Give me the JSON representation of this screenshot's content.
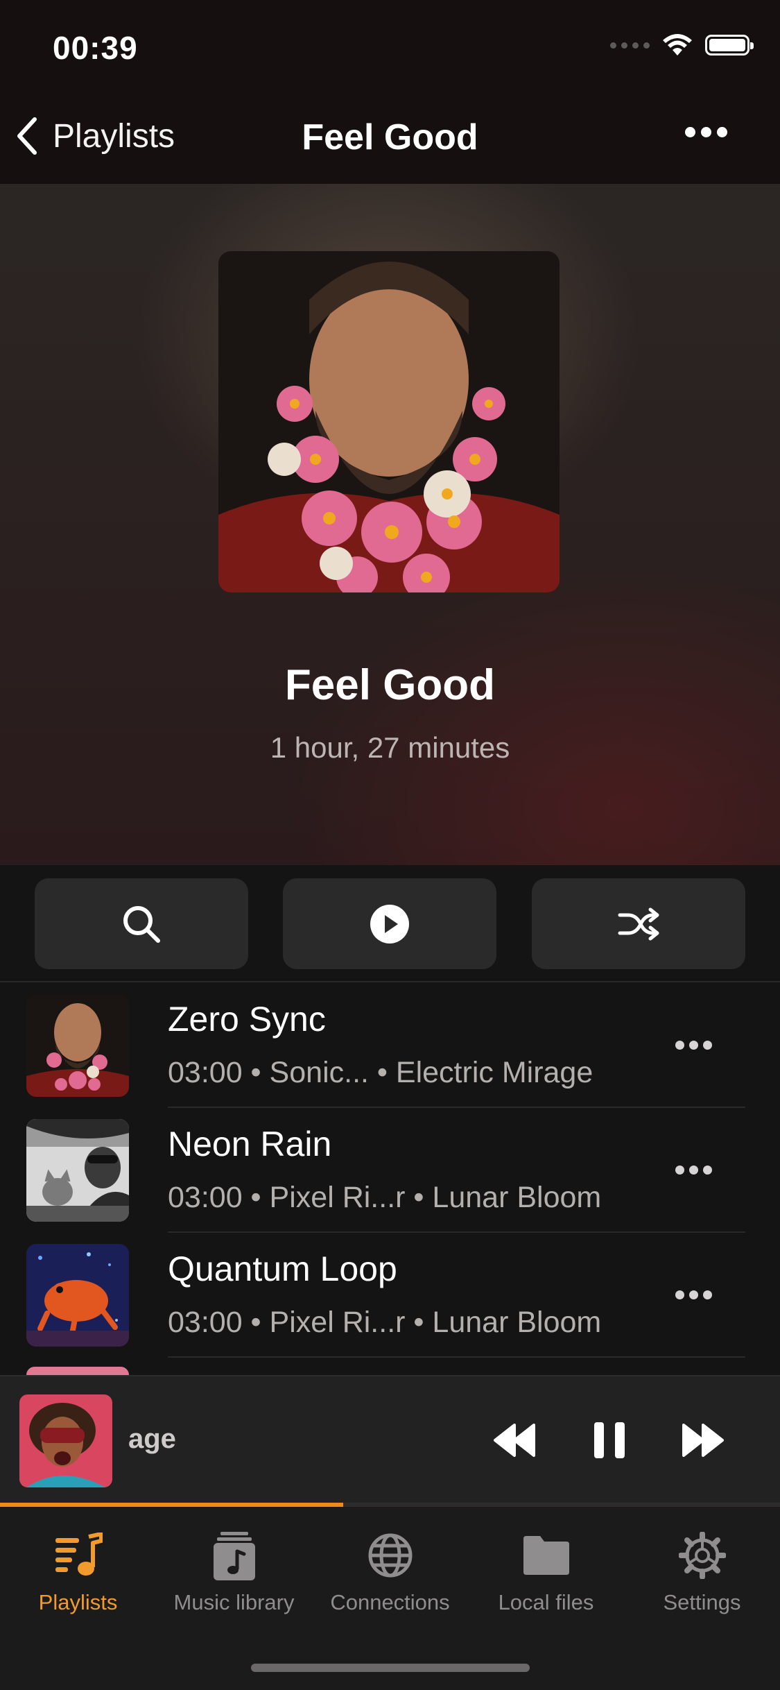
{
  "status_bar": {
    "time": "00:39"
  },
  "nav": {
    "back_label": "Playlists",
    "title": "Feel Good"
  },
  "playlist": {
    "title": "Feel Good",
    "duration": "1 hour, 27 minutes"
  },
  "actions": {
    "search_icon": "search-icon",
    "play_icon": "play-icon",
    "shuffle_icon": "shuffle-icon"
  },
  "tracks": [
    {
      "title": "Zero Sync",
      "meta": "03:00 • Sonic... • Electric Mirage"
    },
    {
      "title": "Neon Rain",
      "meta": "03:00 • Pixel Ri...r • Lunar Bloom"
    },
    {
      "title": "Quantum Loop",
      "meta": "03:00 • Pixel Ri...r • Lunar Bloom"
    }
  ],
  "now_playing": {
    "title_fragment": "age",
    "progress": 0.44
  },
  "tabs": [
    {
      "label": "Playlists",
      "icon": "playlists-icon",
      "active": true
    },
    {
      "label": "Music library",
      "icon": "music-library-icon",
      "active": false
    },
    {
      "label": "Connections",
      "icon": "globe-icon",
      "active": false
    },
    {
      "label": "Local files",
      "icon": "folder-icon",
      "active": false
    },
    {
      "label": "Settings",
      "icon": "gear-icon",
      "active": false
    }
  ],
  "colors": {
    "accent": "#f29a2b",
    "progress": "#f08a1a"
  }
}
